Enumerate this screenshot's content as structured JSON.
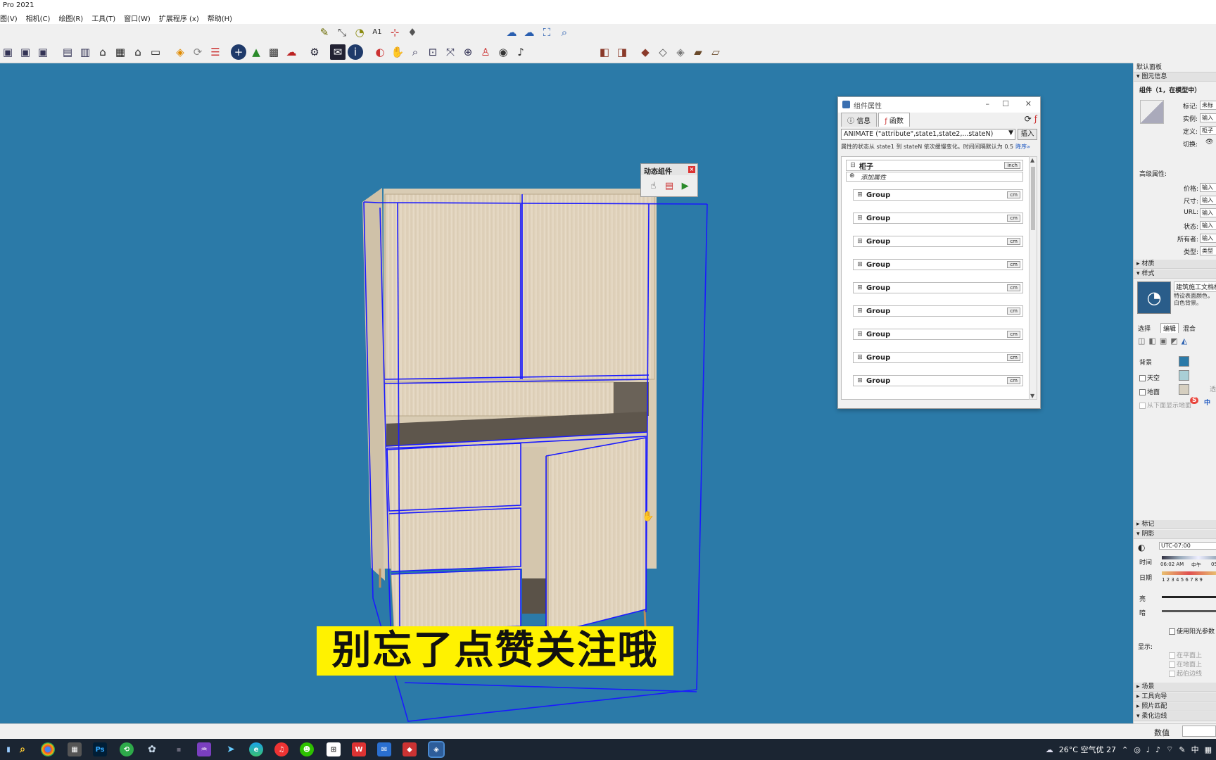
{
  "app": {
    "title": "Pro 2021"
  },
  "menu": [
    "图(V)",
    "相机(C)",
    "绘图(R)",
    "工具(T)",
    "窗口(W)",
    "扩展程序 (x)",
    "帮助(H)"
  ],
  "dynamic_toolbar": {
    "title": "动态组件"
  },
  "subtitle": "别忘了点赞关注哦",
  "attr_window": {
    "title": "组件属性",
    "tabs": [
      "信息",
      "函数"
    ],
    "function": "ANIMATE (\"attribute\",state1,state2,...stateN)",
    "insert_label": "插入",
    "description": "属性的状态从 state1 到 stateN 依次缓慢变化。时间间隔默认为 0.5",
    "more_label": "降序»",
    "root": {
      "name": "柜子",
      "unit": "inch",
      "add_attr": "添加属性"
    },
    "groups": [
      {
        "name": "Group",
        "unit": "cm"
      },
      {
        "name": "Group",
        "unit": "cm"
      },
      {
        "name": "Group",
        "unit": "cm"
      },
      {
        "name": "Group",
        "unit": "cm"
      },
      {
        "name": "Group",
        "unit": "cm"
      },
      {
        "name": "Group",
        "unit": "cm"
      },
      {
        "name": "Group",
        "unit": "cm"
      },
      {
        "name": "Group",
        "unit": "cm"
      },
      {
        "name": "Group",
        "unit": "cm"
      }
    ]
  },
  "right_panel": {
    "tray_title": "默认面板",
    "entity_info": {
      "header": "图元信息",
      "summary": "组件（1，在模型中）",
      "fields": [
        {
          "label": "标记:",
          "value": "未标"
        },
        {
          "label": "实例:",
          "value": "输入"
        },
        {
          "label": "定义:",
          "value": "柜子"
        },
        {
          "label": "切换:",
          "value": ""
        }
      ],
      "advanced_label": "高级属性:",
      "advanced_fields": [
        {
          "label": "价格:",
          "value": "输入"
        },
        {
          "label": "尺寸:",
          "value": "输入"
        },
        {
          "label": "URL:",
          "value": "输入"
        },
        {
          "label": "状态:",
          "value": "输入"
        },
        {
          "label": "所有者:",
          "value": "输入"
        },
        {
          "label": "类型:",
          "value": "类型"
        }
      ]
    },
    "materials_header": "材质",
    "styles": {
      "header": "样式",
      "style_name": "建筑施工文档样",
      "style_desc": "特设表面颜色，白色背景。",
      "tabs": [
        "选择",
        "编辑",
        "混合"
      ],
      "background_label": "背景",
      "sky_label": "天空",
      "ground_label": "地面",
      "transparency_label": "透",
      "show_ground_label": "从下面显示地面",
      "colors": {
        "background": "#2b7aa8",
        "sky": "#a9cfd6",
        "ground": "#d6cfc0"
      }
    },
    "tags_header": "标记",
    "shadows": {
      "header": "阴影",
      "utc": "UTC-07:00",
      "time_label": "时间",
      "time_start": "06:02 AM",
      "time_mid": "中午",
      "time_end": "05",
      "date_label": "日期",
      "date_ticks": "1 2 3 4 5 6 7 8 9",
      "light_label": "亮",
      "dark_label": "暗",
      "use_sun_label": "使用阳光参数",
      "display_label": "显示:",
      "on_faces": "在平面上",
      "on_ground": "在地面上",
      "from_edges": "起伯边线"
    },
    "bottom_headers": [
      "场景",
      "工具向导",
      "照片匹配",
      "柔化边线"
    ]
  },
  "statusbar": {
    "value_label": "数值"
  },
  "tray": {
    "weather": "26°C 空气优 27",
    "ime": "中"
  }
}
